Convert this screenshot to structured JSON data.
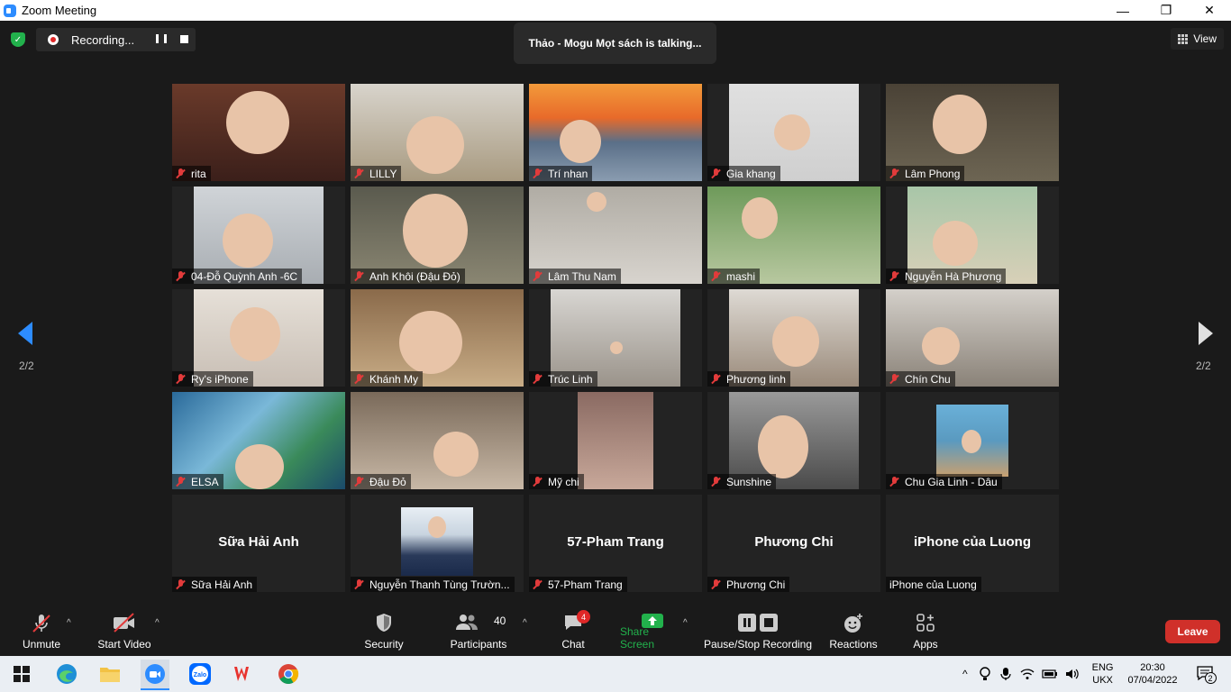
{
  "window": {
    "title": "Zoom Meeting",
    "minimize": "—",
    "restore": "❐",
    "close": "✕"
  },
  "meeting_bar": {
    "recording_label": "Recording...",
    "talking": "Thảo - Mogu Mọt sách is talking...",
    "view_label": "View"
  },
  "pager": {
    "left": "2/2",
    "right": "2/2"
  },
  "participants": [
    {
      "name": "rita",
      "muted": true,
      "video": true
    },
    {
      "name": "LILLY",
      "muted": true,
      "video": true
    },
    {
      "name": "Trí nhan",
      "muted": true,
      "video": true
    },
    {
      "name": "Gia khang",
      "muted": true,
      "video": true
    },
    {
      "name": "Lâm Phong",
      "muted": true,
      "video": true
    },
    {
      "name": "04-Đỗ Quỳnh Anh -6C",
      "muted": true,
      "video": true
    },
    {
      "name": "Anh Khôi (Đậu Đỏ)",
      "muted": true,
      "video": true
    },
    {
      "name": "Lâm Thu Nam",
      "muted": true,
      "video": true
    },
    {
      "name": "mashi",
      "muted": true,
      "video": true
    },
    {
      "name": "Nguyễn Hà Phương",
      "muted": true,
      "video": true
    },
    {
      "name": "Ry's iPhone",
      "muted": true,
      "video": true
    },
    {
      "name": "Khánh My",
      "muted": true,
      "video": true
    },
    {
      "name": "Trúc Linh",
      "muted": true,
      "video": true
    },
    {
      "name": "Phương linh",
      "muted": true,
      "video": true
    },
    {
      "name": "Chín Chu",
      "muted": true,
      "video": true
    },
    {
      "name": "ELSA",
      "muted": true,
      "video": true
    },
    {
      "name": "Đậu Đỏ",
      "muted": true,
      "video": true
    },
    {
      "name": "Mỹ chi",
      "muted": true,
      "video": true
    },
    {
      "name": "Sunshine",
      "muted": true,
      "video": true
    },
    {
      "name": "Chu Gia Linh - Dâu",
      "muted": true,
      "video": true
    },
    {
      "name": "Sữa Hải Anh",
      "muted": true,
      "video": false,
      "display": "Sữa Hải Anh"
    },
    {
      "name": "Nguyễn Thanh Tùng Trườn...",
      "muted": true,
      "video": false,
      "display": ""
    },
    {
      "name": "57-Pham Trang",
      "muted": true,
      "video": false,
      "display": "57-Pham Trang"
    },
    {
      "name": "Phương Chi",
      "muted": true,
      "video": false,
      "display": "Phương Chi"
    },
    {
      "name": "iPhone của Luong",
      "muted": false,
      "video": false,
      "display": "iPhone của Luong"
    }
  ],
  "toolbar": {
    "unmute": "Unmute",
    "start_video": "Start Video",
    "security": "Security",
    "participants": "Participants",
    "participants_count": "40",
    "chat": "Chat",
    "chat_badge": "4",
    "share_screen": "Share Screen",
    "pause_stop_recording": "Pause/Stop Recording",
    "reactions": "Reactions",
    "apps": "Apps",
    "leave": "Leave"
  },
  "taskbar": {
    "lang_top": "ENG",
    "lang_bottom": "UKX",
    "time": "20:30",
    "date": "07/04/2022",
    "notif_count": "2",
    "zalo": "Zalo"
  },
  "colors": {
    "accent": "#2d8cff",
    "leave": "#d0302a",
    "mute": "#e23b3b",
    "share": "#22b14c"
  }
}
